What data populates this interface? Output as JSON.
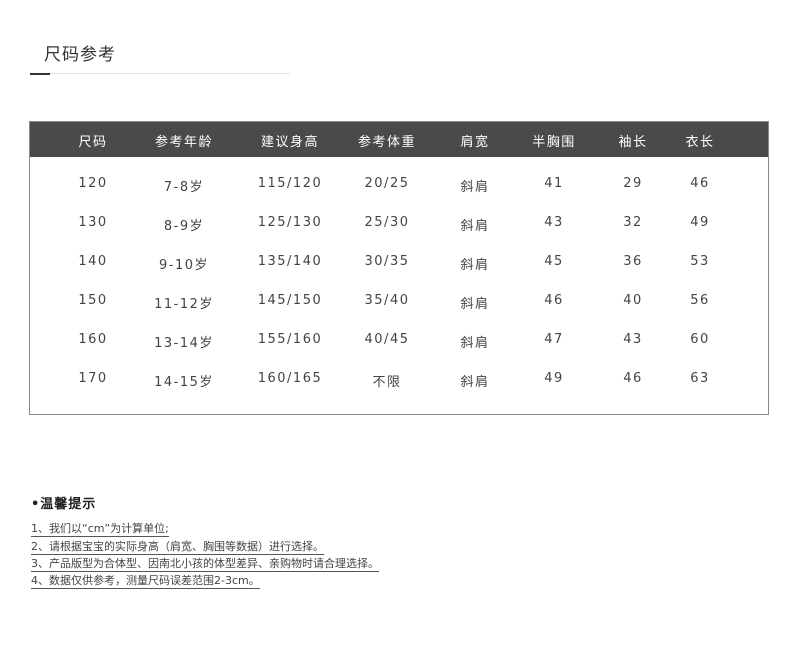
{
  "section": {
    "title": "尺码参考"
  },
  "table": {
    "headers": [
      "尺码",
      "参考年龄",
      "建议身高",
      "参考体重",
      "肩宽",
      "半胸围",
      "袖长",
      "衣长"
    ],
    "rows": [
      [
        "120",
        "7-8岁",
        "115/120",
        "20/25",
        "斜肩",
        "41",
        "29",
        "46"
      ],
      [
        "130",
        "8-9岁",
        "125/130",
        "25/30",
        "斜肩",
        "43",
        "32",
        "49"
      ],
      [
        "140",
        "9-10岁",
        "135/140",
        "30/35",
        "斜肩",
        "45",
        "36",
        "53"
      ],
      [
        "150",
        "11-12岁",
        "145/150",
        "35/40",
        "斜肩",
        "46",
        "40",
        "56"
      ],
      [
        "160",
        "13-14岁",
        "155/160",
        "40/45",
        "斜肩",
        "47",
        "43",
        "60"
      ],
      [
        "170",
        "14-15岁",
        "160/165",
        "不限",
        "斜肩",
        "49",
        "46",
        "63"
      ]
    ]
  },
  "tips": {
    "title": "•温馨提示",
    "items": [
      "1、我们以“cm”为计算单位;",
      "2、请根据宝宝的实际身高（肩宽、胸围等数据）进行选择。",
      "3、产品版型为合体型、因南北小孩的体型差异、亲购物时请合理选择。",
      "4、数据仅供参考，测量尺码误差范围2-3cm。"
    ]
  }
}
